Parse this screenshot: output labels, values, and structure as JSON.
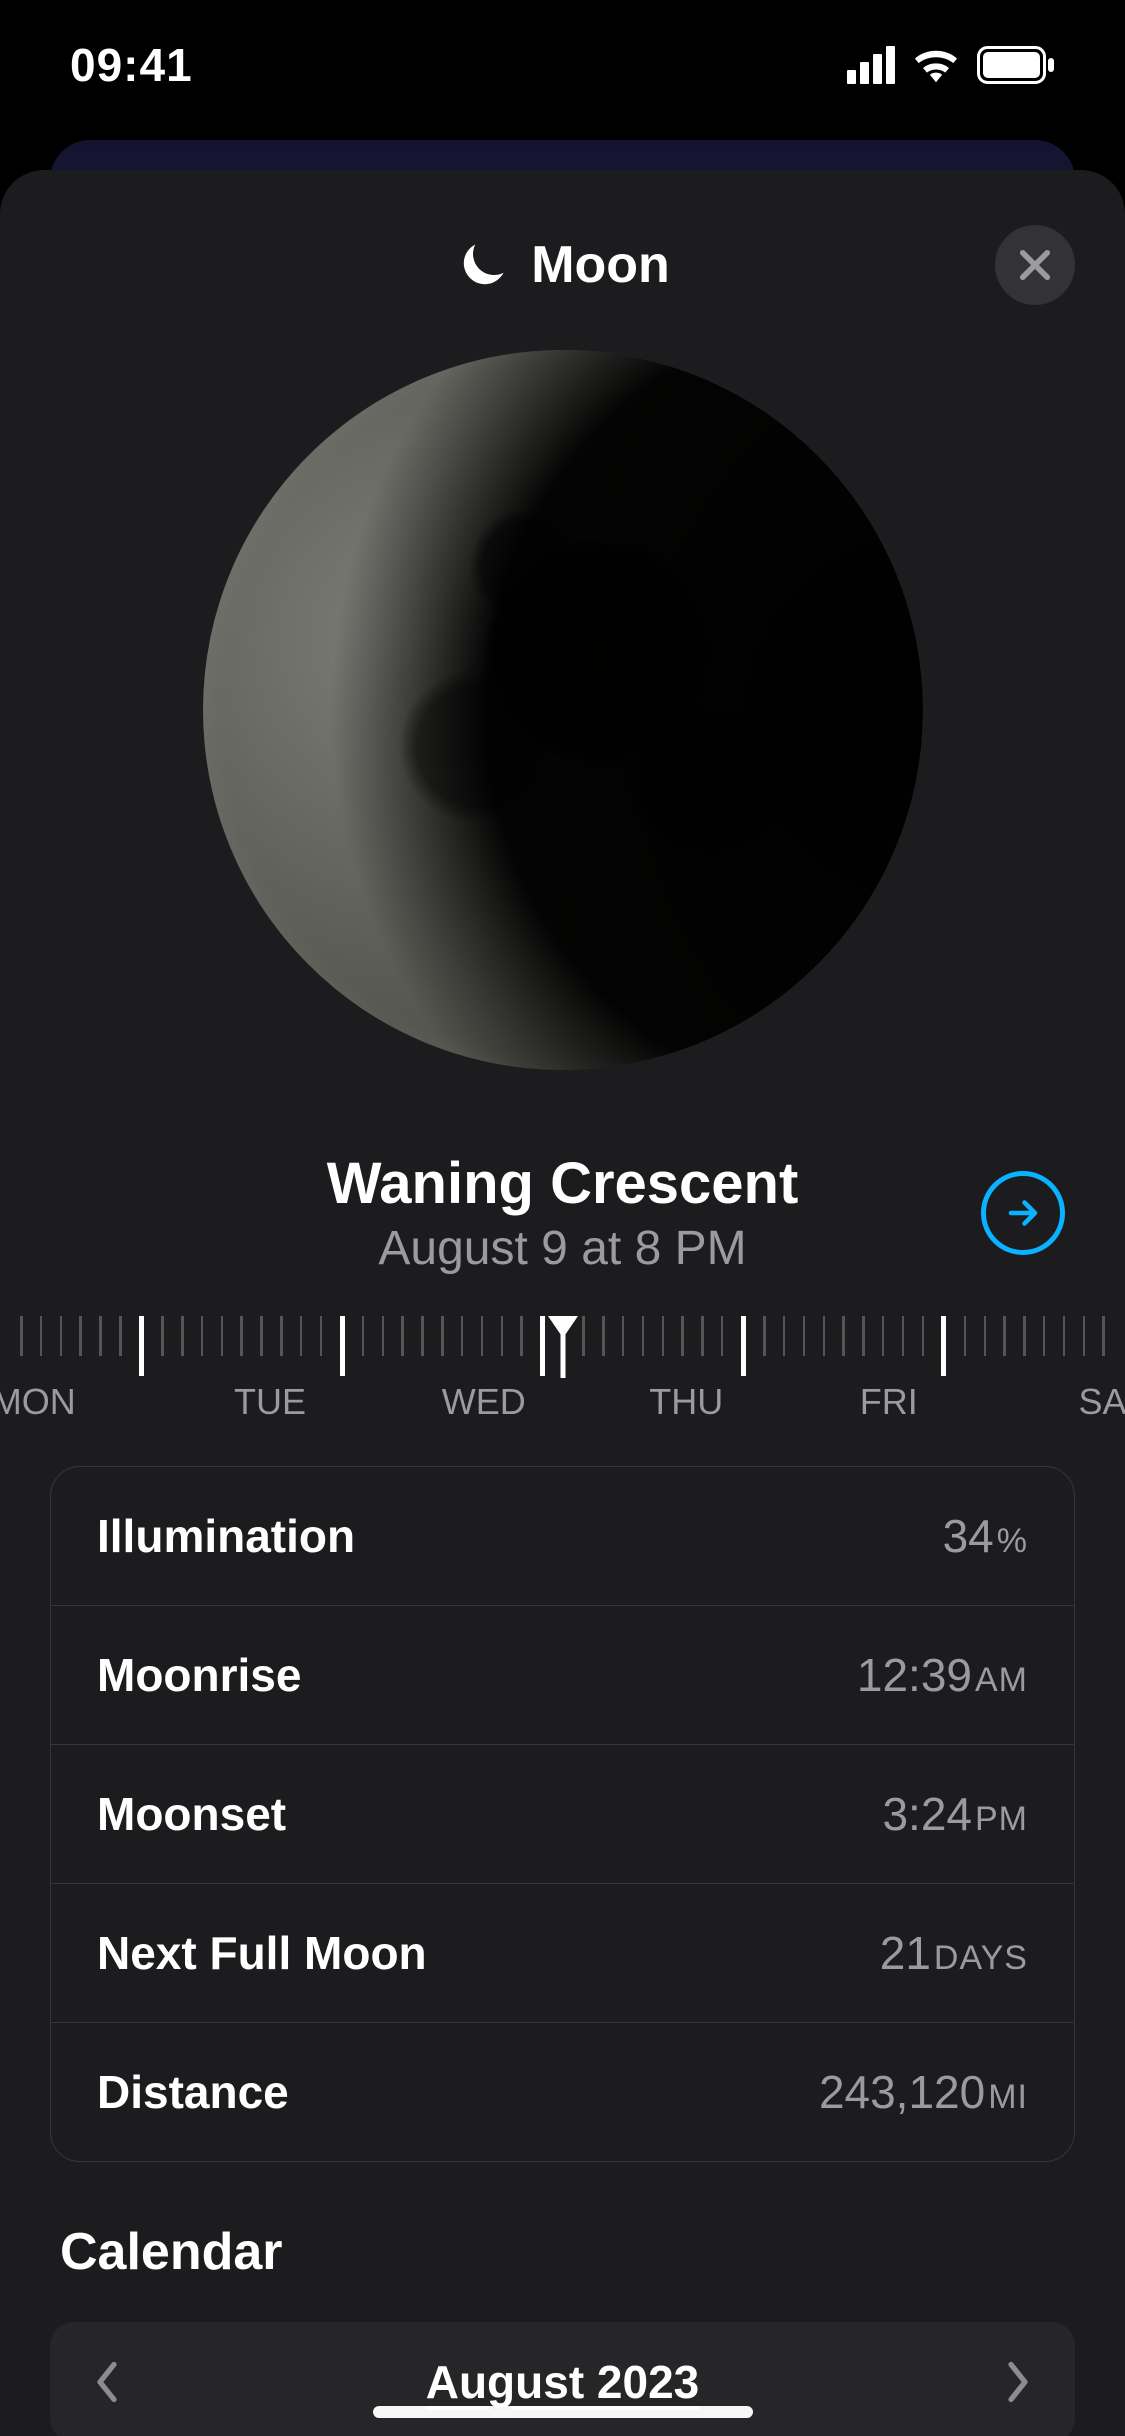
{
  "status": {
    "time": "09:41"
  },
  "header": {
    "title": "Moon"
  },
  "phase": {
    "name": "Waning Crescent",
    "datetime": "August 9 at 8 PM"
  },
  "ruler": {
    "days": [
      "MON",
      "TUE",
      "WED",
      "THU",
      "FRI",
      "SA"
    ]
  },
  "stats": [
    {
      "label": "Illumination",
      "value": "34",
      "unit": "%"
    },
    {
      "label": "Moonrise",
      "value": "12:39",
      "unit": "AM"
    },
    {
      "label": "Moonset",
      "value": "3:24",
      "unit": "PM"
    },
    {
      "label": "Next Full Moon",
      "value": "21",
      "unit": "DAYS"
    },
    {
      "label": "Distance",
      "value": "243,120",
      "unit": "MI"
    }
  ],
  "calendar": {
    "section_title": "Calendar",
    "month_label": "August 2023"
  }
}
